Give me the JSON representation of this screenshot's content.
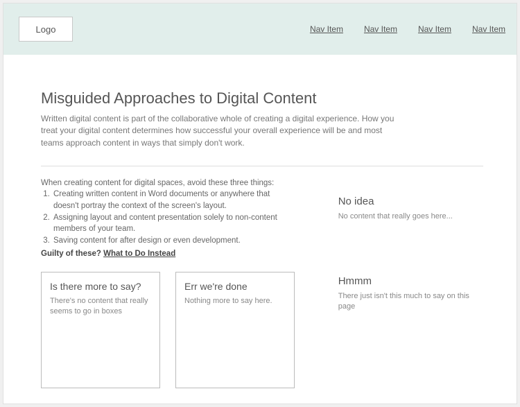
{
  "header": {
    "logo": "Logo",
    "nav": [
      "Nav Item",
      "Nav Item",
      "Nav Item",
      "Nav Item"
    ]
  },
  "main": {
    "title": "Misguided Approaches to Digital Content",
    "intro": "Written digital content is part of the collaborative whole of creating a digital experience. How you treat your digital content determines how successful your overall experience will be and most teams approach content in ways that simply don't work.",
    "lead": "When creating content for digital spaces, avoid these three things:",
    "points": [
      "Creating written content in Word documents or anywhere that doesn't portray the context of the screen's layout.",
      "Assigning layout and content presentation solely to non-content members of your team.",
      "Saving content for after design or even development."
    ],
    "guilty_prefix": "Guilty of these? ",
    "guilty_link": "What to Do Instead",
    "boxes": [
      {
        "title": "Is there more to say?",
        "text": "There's no content that really seems to go in boxes"
      },
      {
        "title": "Err we're done",
        "text": "Nothing more to say here."
      }
    ]
  },
  "sidebar": {
    "blocks": [
      {
        "title": "No idea",
        "text": "No content that really goes here..."
      },
      {
        "title": "Hmmm",
        "text": "There just isn't this much to say on this page"
      }
    ]
  }
}
